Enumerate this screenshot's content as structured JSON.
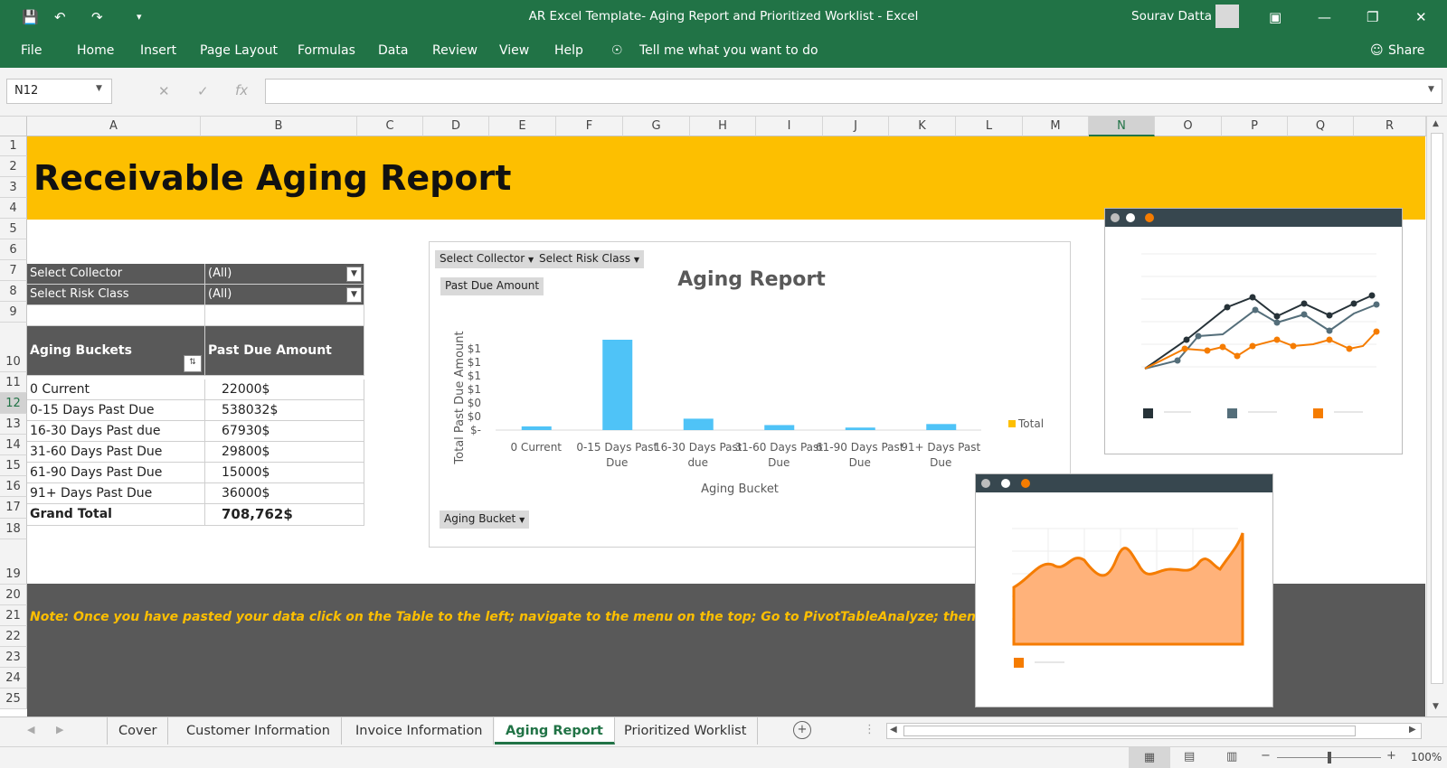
{
  "titlebar": {
    "title": "AR Excel Template- Aging Report and Prioritized Worklist  -  Excel",
    "user": "Sourav Datta"
  },
  "ribbon": {
    "tabs": [
      "File",
      "Home",
      "Insert",
      "Page Layout",
      "Formulas",
      "Data",
      "Review",
      "View",
      "Help"
    ],
    "tell_me": "Tell me what you want to do",
    "share": "Share"
  },
  "formula_bar": {
    "name_box": "N12",
    "formula": ""
  },
  "columns": [
    "A",
    "B",
    "C",
    "D",
    "E",
    "F",
    "G",
    "H",
    "I",
    "J",
    "K",
    "L",
    "M",
    "N",
    "O",
    "P",
    "Q",
    "R"
  ],
  "rows": [
    "1",
    "2",
    "3",
    "4",
    "5",
    "6",
    "7",
    "8",
    "9",
    "10",
    "11",
    "12",
    "13",
    "14",
    "15",
    "16",
    "17",
    "18",
    "19",
    "20",
    "21",
    "22",
    "23",
    "24",
    "25"
  ],
  "sheet": {
    "title": "Receivable Aging Report",
    "filters": [
      {
        "label": "Select Collector",
        "value": "(All)"
      },
      {
        "label": "Select Risk Class",
        "value": "(All)"
      }
    ],
    "table": {
      "headers": [
        "Aging Buckets",
        "Past Due Amount"
      ],
      "rows": [
        {
          "bucket": "0 Current",
          "amount": "22000$"
        },
        {
          "bucket": "0-15 Days Past Due",
          "amount": "538032$"
        },
        {
          "bucket": "16-30 Days Past due",
          "amount": "67930$"
        },
        {
          "bucket": "31-60 Days Past Due",
          "amount": "29800$"
        },
        {
          "bucket": "61-90 Days Past Due",
          "amount": "15000$"
        },
        {
          "bucket": "91+ Days Past Due",
          "amount": "36000$"
        }
      ],
      "total_label": "Grand Total",
      "total_value": "708,762$"
    },
    "note": "Note: Once you have pasted your data click on the Table to the left; navigate to the menu on the top; Go to PivotTableAnalyze; then select Refresh"
  },
  "pivot_buttons": {
    "collector": "Select Collector",
    "risk": "Select Risk Class",
    "values": "Past Due Amount",
    "axis": "Aging Bucket"
  },
  "chart_data": {
    "type": "bar",
    "title": "Aging Report",
    "xlabel": "Aging Bucket",
    "ylabel": "Total Past Due Amount",
    "categories": [
      "0 Current",
      "0-15 Days Past Due",
      "16-30 Days Past due",
      "31-60 Days Past Due",
      "61-90 Days Past Due",
      "91+ Days Past Due"
    ],
    "category_lines": [
      [
        "0 Current"
      ],
      [
        "0-15 Days Past",
        "Due"
      ],
      [
        "16-30 Days Past",
        "due"
      ],
      [
        "31-60 Days Past",
        "Due"
      ],
      [
        "61-90 Days Past",
        "Due"
      ],
      [
        "91+ Days Past",
        "Due"
      ]
    ],
    "series": [
      {
        "name": "Total",
        "values": [
          22000,
          538032,
          67930,
          29800,
          15000,
          36000
        ]
      }
    ],
    "ytick_labels": [
      "$1",
      "$1",
      "$1",
      "$1",
      "$0",
      "$0",
      "$-"
    ],
    "legend_position": "right",
    "color": "#4fc3f7"
  },
  "sheet_tabs": [
    "Cover",
    "Customer Information",
    "Invoice Information",
    "Aging Report",
    "Prioritized Worklist"
  ],
  "active_tab": "Aging Report",
  "status": {
    "zoom": "100%"
  }
}
